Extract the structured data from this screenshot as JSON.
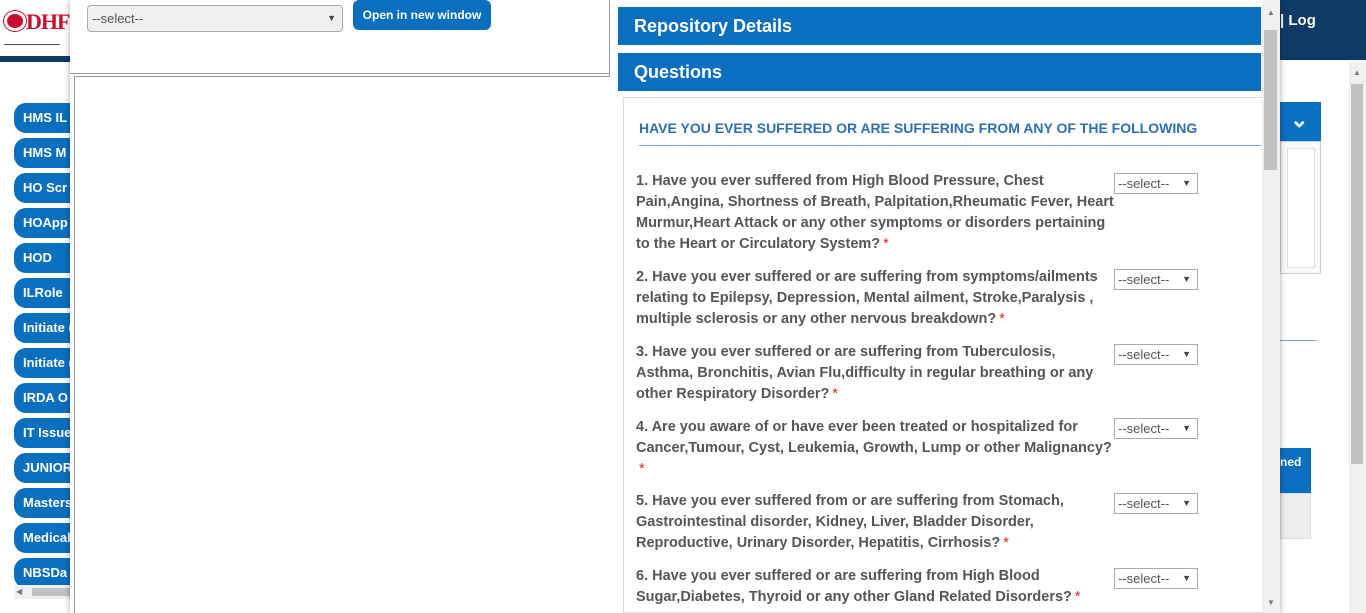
{
  "background": {
    "logo_text": "DHF",
    "top_right_text": "| Log",
    "menu_items": [
      "HMS IL",
      "HMS M",
      "HO Scr",
      "HOApp",
      "HOD",
      "ILRole",
      "Initiate (",
      "Initiate (",
      "IRDA O",
      "IT Issue",
      "JUNIOR",
      "Masters",
      "Medical",
      "NBSDa"
    ],
    "blue_card_text": "ned",
    "collapse_icon": "chevron-down-icon"
  },
  "modal": {
    "document_select": {
      "value": "--select--"
    },
    "open_button": "Open in new window",
    "sections": {
      "repository": "Repository Details",
      "questions": "Questions"
    },
    "questions_heading": "HAVE YOU EVER SUFFERED OR ARE SUFFERING FROM ANY OF THE FOLLOWING",
    "required_mark": "*",
    "questions": [
      {
        "text": "1. Have you ever suffered from High Blood Pressure, Chest Pain,Angina, Shortness of Breath, Palpitation,Rheumatic Fever, Heart Murmur,Heart Attack or any other symptoms or disorders pertaining to the Heart or Circulatory System?",
        "answer": "--select--"
      },
      {
        "text": "2. Have you ever suffered or are suffering from symptoms/ailments relating to Epilepsy, Depression, Mental ailment, Stroke,Paralysis , multiple sclerosis or any other nervous breakdown?",
        "answer": "--select--"
      },
      {
        "text": "3. Have you ever suffered or are suffering from Tuberculosis, Asthma, Bronchitis, Avian Flu,difficulty in regular breathing or any other Respiratory Disorder?",
        "answer": "--select--"
      },
      {
        "text": "4. Are you aware of or have ever been treated or hospitalized for Cancer,Tumour, Cyst, Leukemia, Growth, Lump or other Malignancy?",
        "answer": "--select--"
      },
      {
        "text": "5. Have you ever suffered from or are suffering from Stomach, Gastrointestinal disorder, Kidney, Liver, Bladder Disorder, Reproductive, Urinary Disorder, Hepatitis, Cirrhosis?",
        "answer": "--select--"
      },
      {
        "text": "6. Have you ever suffered or are suffering from High Blood Sugar,Diabetes, Thyroid or any other Gland Related Disorders?",
        "answer": "--select--"
      }
    ]
  }
}
